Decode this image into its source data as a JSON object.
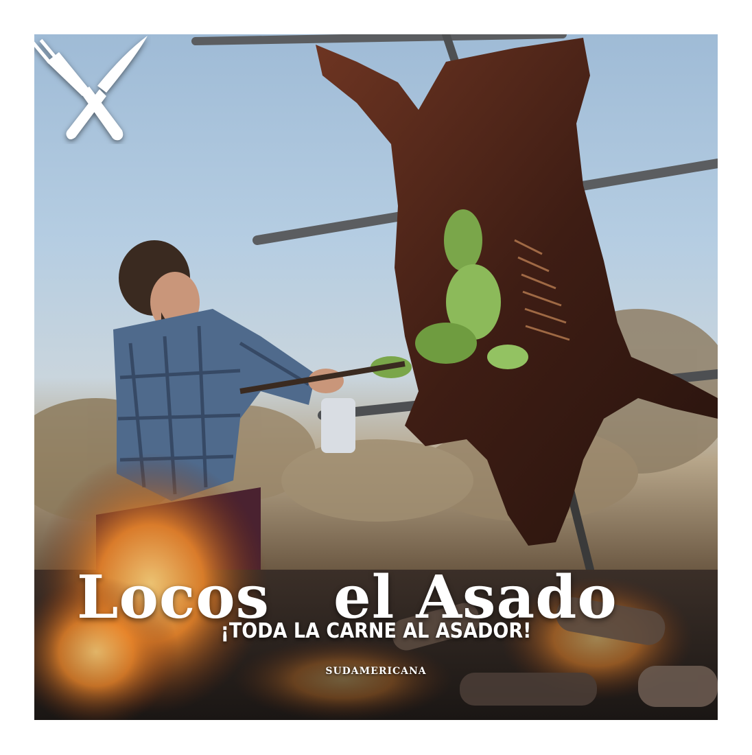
{
  "cover": {
    "title_left": "Locos",
    "title_right": "el Asado",
    "tagline": "¡TODA LA CARNE AL ASADOR!",
    "publisher": "SUDAMERICANA"
  },
  "icons": {
    "title_separator": "crossed-fork-knife-icon"
  },
  "colors": {
    "sky": "#a9c3dc",
    "meat": "#5a2a1c",
    "flame": "#e07a20",
    "text": "#ffffff"
  }
}
